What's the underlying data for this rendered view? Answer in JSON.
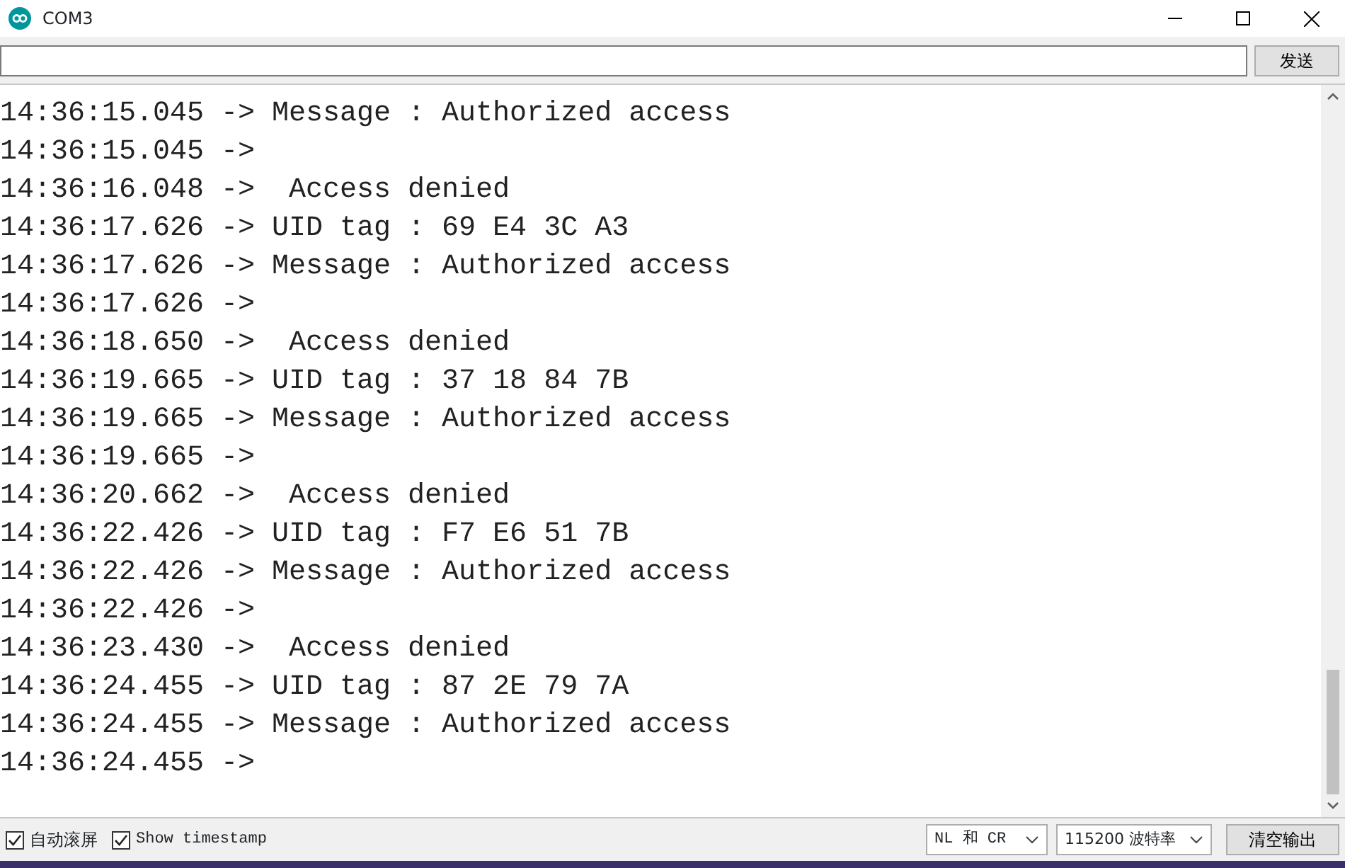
{
  "window": {
    "title": "COM3"
  },
  "send": {
    "button": "发送"
  },
  "lines": [
    "14:36:15.045 -> Message : Authorized access",
    "14:36:15.045 -> ",
    "14:36:16.048 ->  Access denied",
    "14:36:17.626 -> UID tag : 69 E4 3C A3",
    "14:36:17.626 -> Message : Authorized access",
    "14:36:17.626 -> ",
    "14:36:18.650 ->  Access denied",
    "14:36:19.665 -> UID tag : 37 18 84 7B",
    "14:36:19.665 -> Message : Authorized access",
    "14:36:19.665 -> ",
    "14:36:20.662 ->  Access denied",
    "14:36:22.426 -> UID tag : F7 E6 51 7B",
    "14:36:22.426 -> Message : Authorized access",
    "14:36:22.426 -> ",
    "14:36:23.430 ->  Access denied",
    "14:36:24.455 -> UID tag : 87 2E 79 7A",
    "14:36:24.455 -> Message : Authorized access",
    "14:36:24.455 -> "
  ],
  "options": [
    {
      "label": "自动滚屏",
      "checked": true
    },
    {
      "label": "Show timestamp",
      "checked": true
    }
  ],
  "selects": [
    {
      "value": "NL 和 CR"
    },
    {
      "value": "115200 波特率"
    }
  ],
  "clear_button": "清空输出"
}
